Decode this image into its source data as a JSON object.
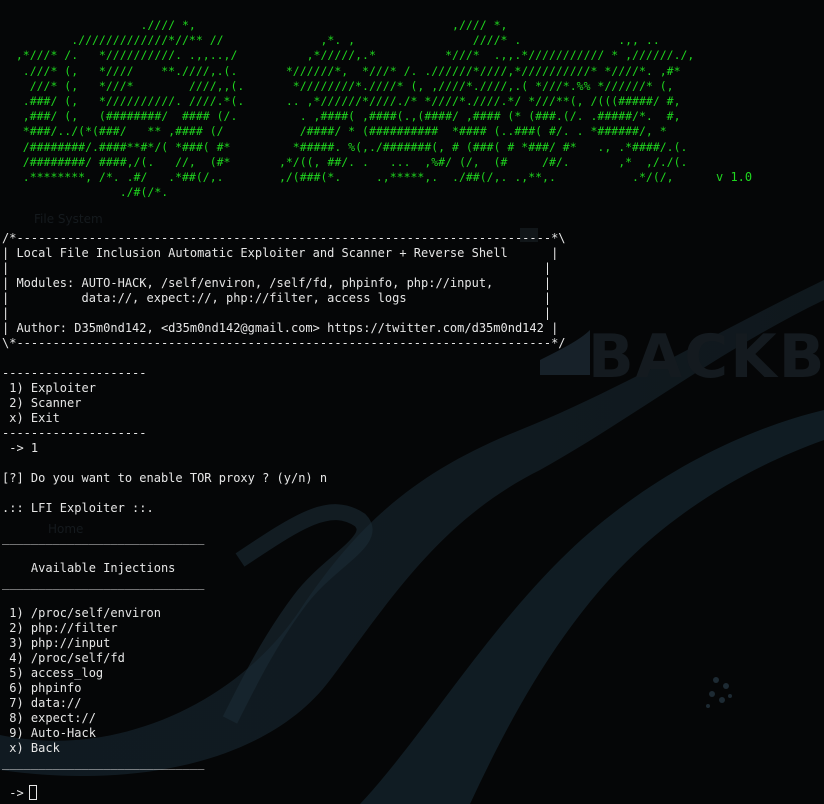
{
  "wallpaper": {
    "watermark_text": "BACKBO",
    "label_file_system": "File System",
    "label_home": "Home"
  },
  "logo_ascii": "                    .//// *,                                     ,//// *,\n          ./////////////*//** //              ,*. ,                 ////* .              .,, ..\n  ,*///* /.   *//////////. .,,..,/          ,*/////,.*          *///*  .,,.*/////////// * ,//////./,\n   .///* (,   *////    **.////,.(.       *//////*,  *///* /. .//////*////,*//////////* *////*. ,#*\n    ///* (,   *///*        ////,,(.       *////////*.////* (, ,////*.////,.( *///*.%% *//////* (,\n   .###/ (,   *//////////. ////.*(.      .. ,*//////*////./* *////*.////.*/ *///**(, /(((#####/ #,\n   ,###/ (,   (########/  #### (/.         . ,####( ,####(.,(####/ ,#### (* (###.(/. .#####/*.  #,\n   *###/../(*(###/   ** ,#### (/           /####/ * (##########  *#### (..###( #/. . *######/, *\n   /########/.####**#*/( *###( #*         *#####. %(,./#######(, # (###( # *###/ #*   ., .*####/.(.\n   /########/ ####,/(.   //,  (#*       ,*/((, ##/. .   ...  ,%#/ (/,  (#     /#/.       ,*  ,/./(.\n   .********, /*. .#/   .*##(/,.        ,/(###(*.     .,*****,.  ./##(/,. .,**,.           .*/(/,\n                 ./#(/*.",
  "version": "v 1.0",
  "banner": {
    "border_top": "/*--------------------------------------------------------------------------*\\",
    "title": "| Local File Inclusion Automatic Exploiter and Scanner + Reverse Shell      |",
    "blank1": "|                                                                          |",
    "modules1": "| Modules: AUTO-HACK, /self/environ, /self/fd, phpinfo, php://input,       |",
    "modules2": "|          data://, expect://, php://filter, access logs                   |",
    "blank2": "|                                                                          |",
    "author": "| Author: D35m0nd142, <d35m0nd142@gmail.com> https://twitter.com/d35m0nd142 |",
    "border_bottom": "\\*--------------------------------------------------------------------------*/"
  },
  "main_menu": {
    "separator": "--------------------",
    "items": [
      " 1) Exploiter",
      " 2) Scanner",
      " x) Exit"
    ],
    "prompt": " -> 1"
  },
  "tor_question": "[?] Do you want to enable TOR proxy ? (y/n) n",
  "exploiter_header": ".:: LFI Exploiter ::.",
  "injections": {
    "rule": "____________________________",
    "title": "    Available Injections",
    "items": [
      " 1) /proc/self/environ",
      " 2) php://filter",
      " 3) php://input",
      " 4) /proc/self/fd",
      " 5) access_log",
      " 6) phpinfo",
      " 7) data://",
      " 8) expect://",
      " 9) Auto-Hack",
      " x) Back"
    ],
    "prompt": " -> "
  },
  "colors": {
    "background": "#050607",
    "logo_green": "#1fd61f",
    "text": "#e6e6e6"
  }
}
